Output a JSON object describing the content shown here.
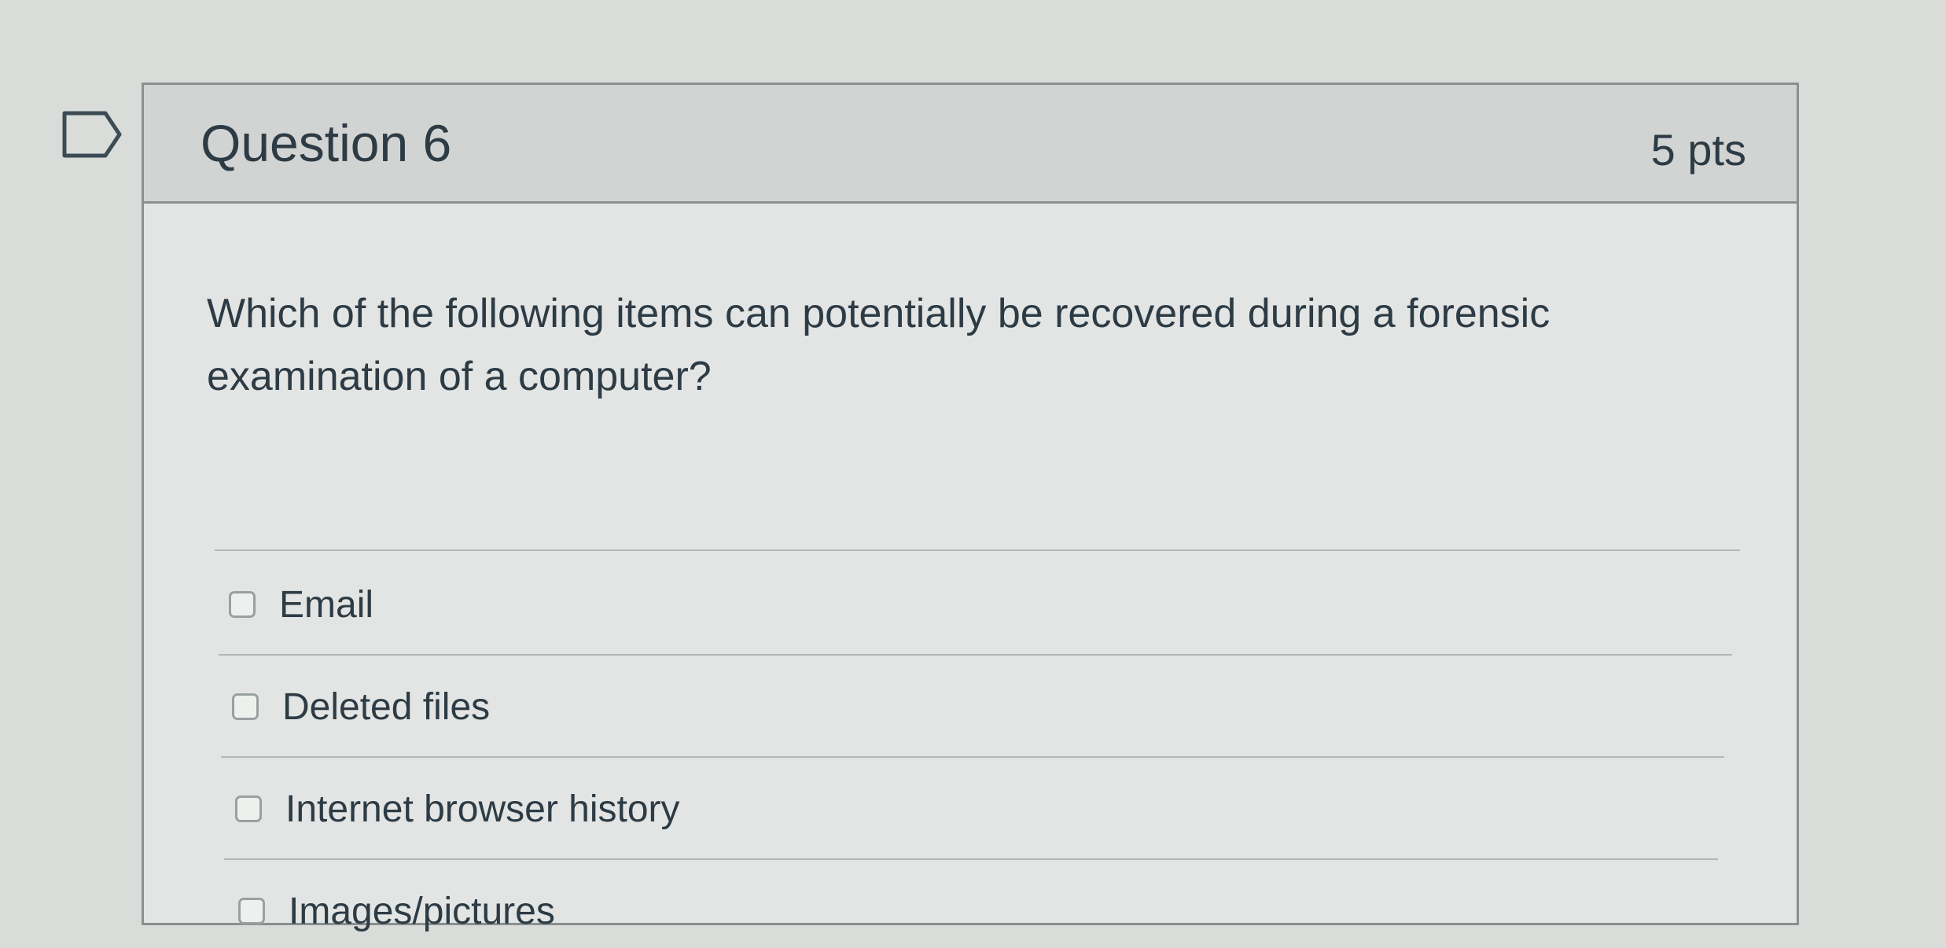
{
  "question": {
    "title": "Question 6",
    "points": "5 pts",
    "text": "Which of the following items can potentially be recovered during a forensic examination of a computer?",
    "answers": [
      {
        "label": "Email",
        "checked": false
      },
      {
        "label": "Deleted files",
        "checked": false
      },
      {
        "label": "Internet browser history",
        "checked": false
      },
      {
        "label": "Images/pictures",
        "checked": false
      }
    ]
  },
  "icons": {
    "bookmark": "bookmark-flag-icon"
  },
  "colors": {
    "background": "#d9dcd9",
    "card": "#e2e5e3",
    "header": "#d1d4d2",
    "text": "#2d3b45",
    "border": "#8a8f90"
  }
}
